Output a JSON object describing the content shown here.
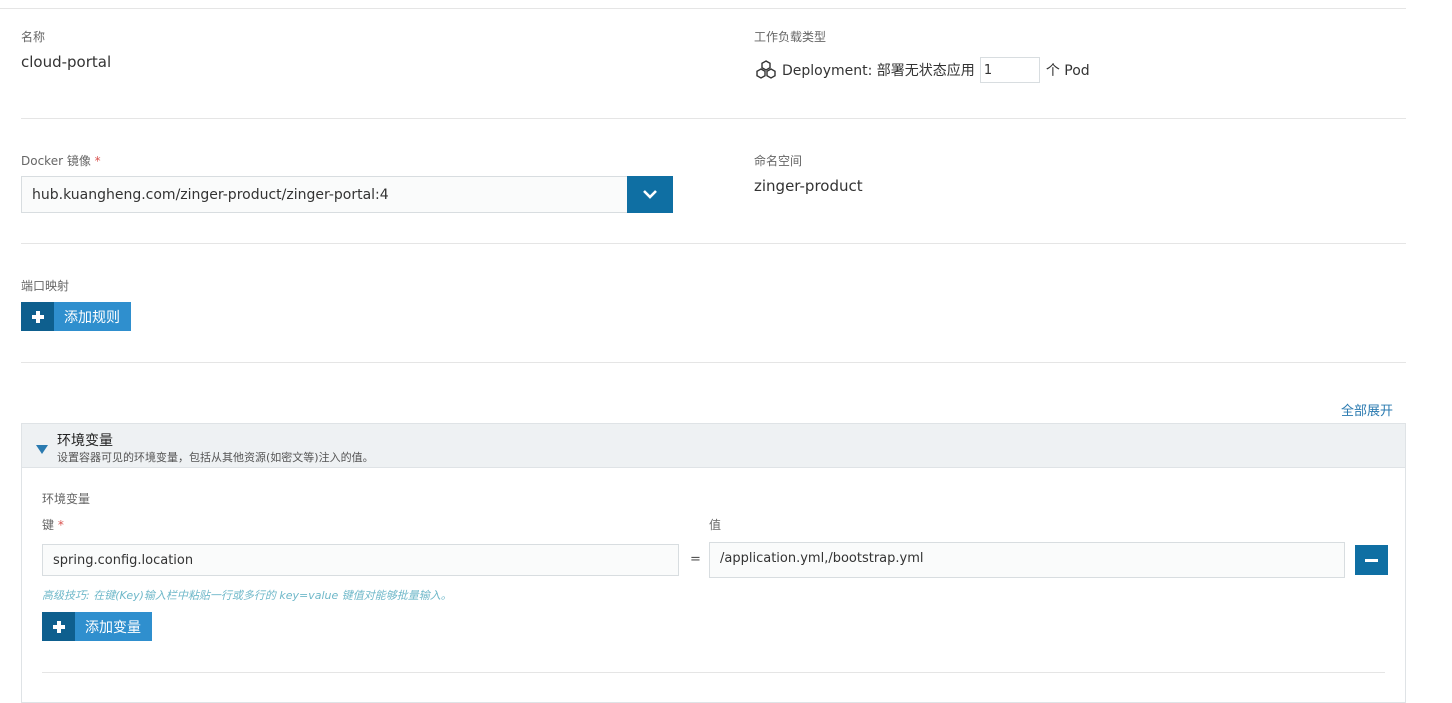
{
  "name_section": {
    "label": "名称",
    "value": "cloud-portal"
  },
  "workload": {
    "label": "工作负载类型",
    "icon": "deployment-icon",
    "type_text": "Deployment: 部署无状态应用",
    "replicas": "1",
    "unit": "个 Pod"
  },
  "docker": {
    "label": "Docker 镜像",
    "required_mark": "*",
    "value": "hub.kuangheng.com/zinger-product/zinger-portal:4",
    "dropdown_icon": "chevron-down-icon"
  },
  "namespace": {
    "label": "命名空间",
    "value": "zinger-product"
  },
  "ports": {
    "label": "端口映射",
    "add_label": "添加规则"
  },
  "expand_all": "全部展开",
  "env_panel": {
    "title": "环境变量",
    "description": "设置容器可见的环境变量，包括从其他资源(如密文等)注入的值。",
    "section_label": "环境变量",
    "key_label": "键",
    "required_mark": "*",
    "value_label": "值",
    "rows": [
      {
        "key": "spring.config.location",
        "equals": "=",
        "value": "/application.yml,/bootstrap.yml"
      }
    ],
    "tip": "高级技巧: 在键(Key)输入栏中粘贴一行或多行的 key=value 键值对能够批量输入。",
    "add_label": "添加变量"
  },
  "colors": {
    "primary": "#0f6fa3",
    "button_light": "#2f8fce",
    "link": "#2a7ab0",
    "tip": "#6fb8c9",
    "required": "#d9534f"
  }
}
